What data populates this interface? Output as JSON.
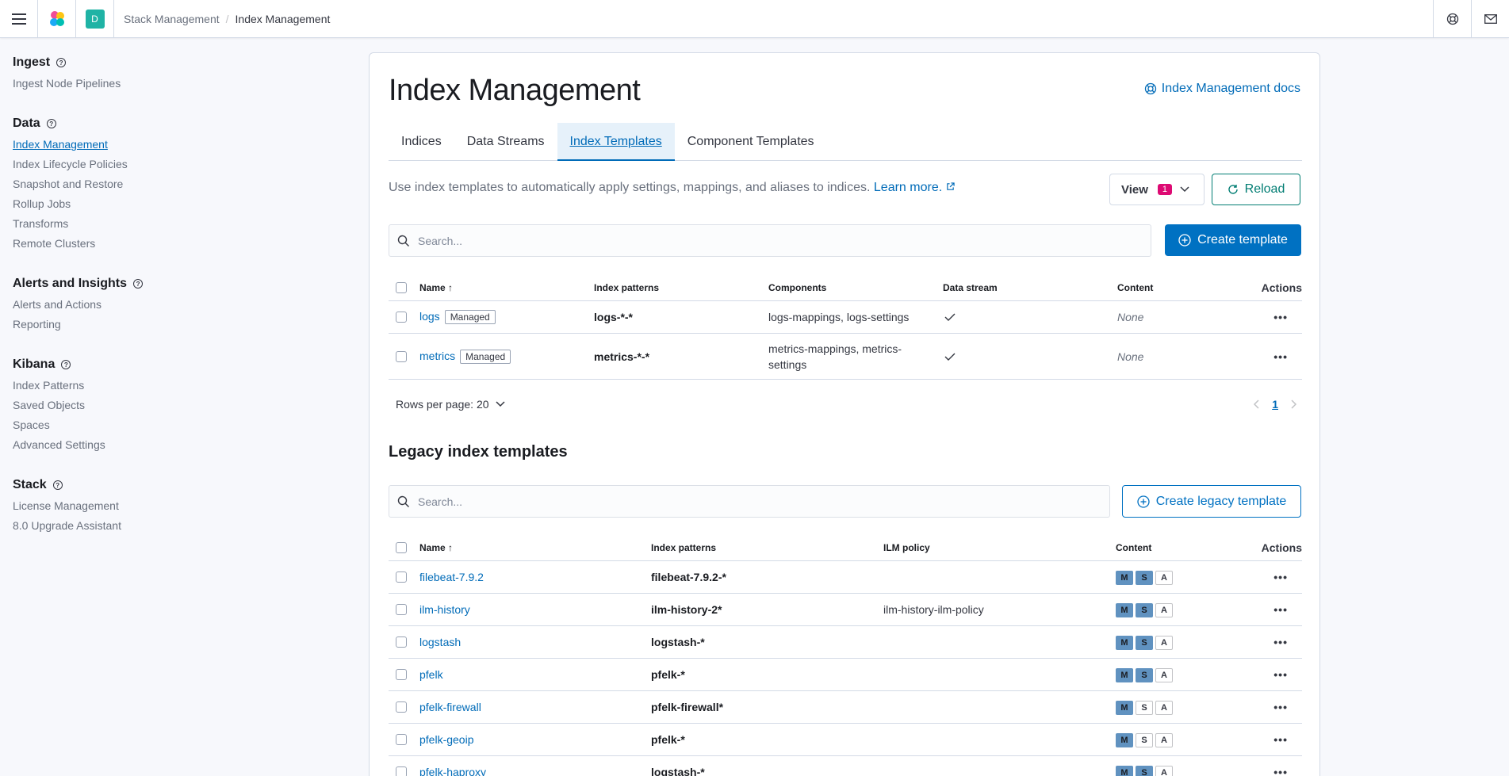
{
  "header": {
    "breadcrumbs": [
      "Stack Management",
      "Index Management"
    ],
    "app_badge": "D"
  },
  "sidebar": {
    "groups": [
      {
        "title": "Ingest",
        "items": [
          "Ingest Node Pipelines"
        ]
      },
      {
        "title": "Data",
        "items": [
          "Index Management",
          "Index Lifecycle Policies",
          "Snapshot and Restore",
          "Rollup Jobs",
          "Transforms",
          "Remote Clusters"
        ]
      },
      {
        "title": "Alerts and Insights",
        "items": [
          "Alerts and Actions",
          "Reporting"
        ]
      },
      {
        "title": "Kibana",
        "items": [
          "Index Patterns",
          "Saved Objects",
          "Spaces",
          "Advanced Settings"
        ]
      },
      {
        "title": "Stack",
        "items": [
          "License Management",
          "8.0 Upgrade Assistant"
        ]
      }
    ],
    "active_item": "Index Management"
  },
  "main": {
    "title": "Index Management",
    "docs_link": "Index Management docs",
    "tabs": [
      "Indices",
      "Data Streams",
      "Index Templates",
      "Component Templates"
    ],
    "active_tab": "Index Templates",
    "description": "Use index templates to automatically apply settings, mappings, and aliases to indices.",
    "learn_more": "Learn more.",
    "view_label": "View",
    "view_count": "1",
    "reload_label": "Reload",
    "search_placeholder": "Search...",
    "create_label": "Create template",
    "templates_table": {
      "headers": [
        "Name",
        "Index patterns",
        "Components",
        "Data stream",
        "Content",
        "Actions"
      ],
      "rows": [
        {
          "name": "logs",
          "badge": "Managed",
          "pattern": "logs-*-*",
          "components": "logs-mappings, logs-settings",
          "data_stream": true,
          "content": "None"
        },
        {
          "name": "metrics",
          "badge": "Managed",
          "pattern": "metrics-*-*",
          "components": "metrics-mappings, metrics-settings",
          "data_stream": true,
          "content": "None"
        }
      ]
    },
    "rows_per_page": "Rows per page: 20",
    "current_page": "1",
    "legacy_title": "Legacy index templates",
    "legacy_search_placeholder": "Search...",
    "create_legacy_label": "Create legacy template",
    "legacy_table": {
      "headers": [
        "Name",
        "Index patterns",
        "ILM policy",
        "Content",
        "Actions"
      ],
      "content_letters": [
        "M",
        "S",
        "A"
      ],
      "rows": [
        {
          "name": "filebeat-7.9.2",
          "pattern": "filebeat-7.9.2-*",
          "ilm": "",
          "m": true,
          "s": true,
          "a": false
        },
        {
          "name": "ilm-history",
          "pattern": "ilm-history-2*",
          "ilm": "ilm-history-ilm-policy",
          "m": true,
          "s": true,
          "a": false
        },
        {
          "name": "logstash",
          "pattern": "logstash-*",
          "ilm": "",
          "m": true,
          "s": true,
          "a": false
        },
        {
          "name": "pfelk",
          "pattern": "pfelk-*",
          "ilm": "",
          "m": true,
          "s": true,
          "a": false
        },
        {
          "name": "pfelk-firewall",
          "pattern": "pfelk-firewall*",
          "ilm": "",
          "m": true,
          "s": false,
          "a": false
        },
        {
          "name": "pfelk-geoip",
          "pattern": "pfelk-*",
          "ilm": "",
          "m": true,
          "s": false,
          "a": false
        },
        {
          "name": "pfelk-haproxy",
          "pattern": "logstash-*",
          "ilm": "",
          "m": true,
          "s": true,
          "a": false
        }
      ]
    }
  }
}
